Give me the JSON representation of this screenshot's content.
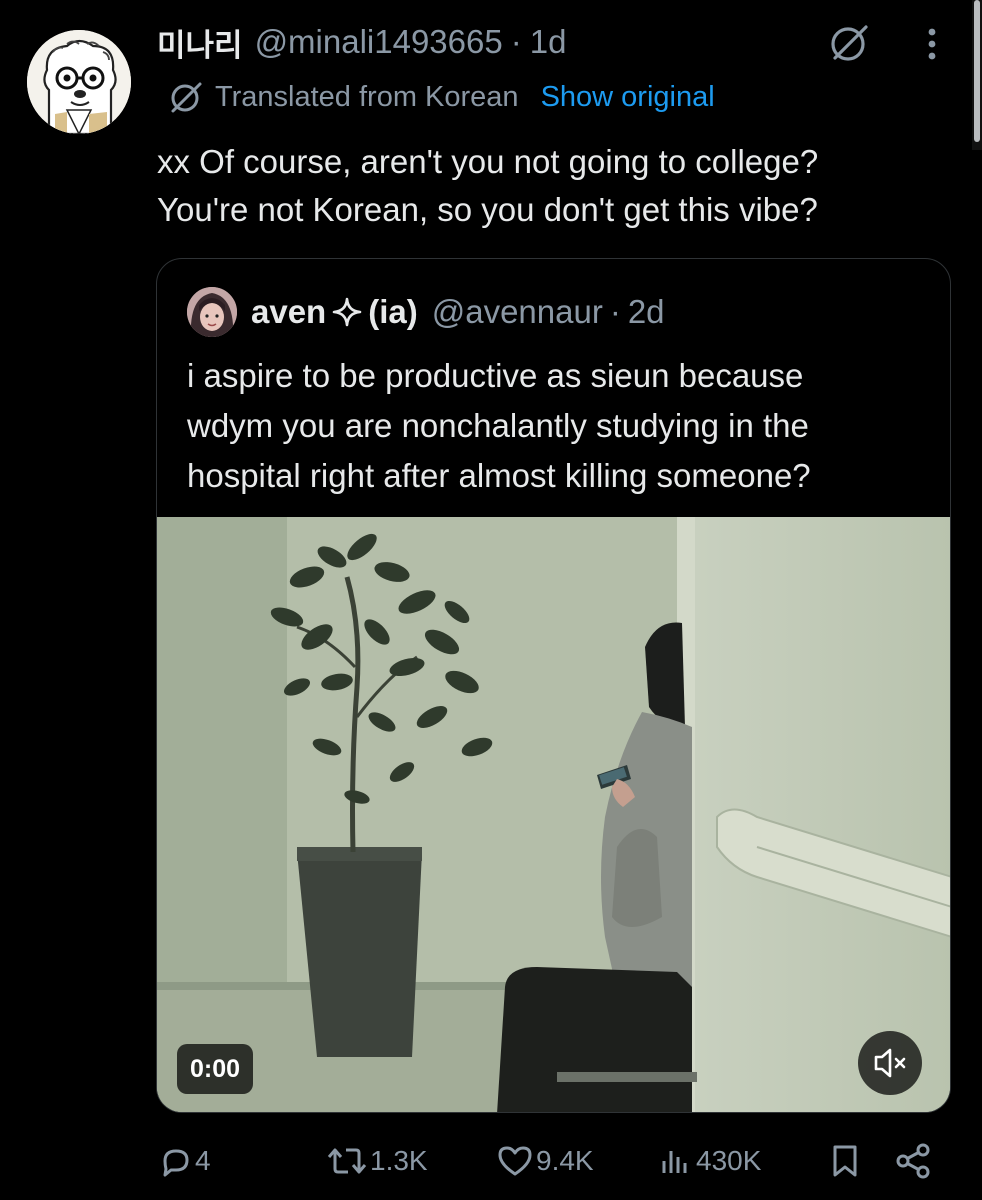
{
  "tweet": {
    "display_name": "미나리",
    "handle": "@minali1493665",
    "separator": "·",
    "time": "1d",
    "translated_label": "Translated from Korean",
    "show_original_label": "Show original",
    "text_line1": "xx Of course, aren't you not going to college?",
    "text_line2": "You're not Korean, so you don't get this vibe?"
  },
  "quote": {
    "name": "aven",
    "affiliation": "(ia)",
    "handle": "@avennaur",
    "separator": "·",
    "time": "2d",
    "text_line1": "i aspire to be productive as sieun because",
    "text_line2": "wdym you are nonchalantly studying in the",
    "text_line3": "hospital right after almost killing someone?",
    "video_time": "0:00"
  },
  "actions": {
    "replies": "4",
    "reposts": "1.3K",
    "likes": "9.4K",
    "views": "430K"
  },
  "colors": {
    "background": "#000000",
    "text": "#e7e9ea",
    "muted": "#8b98a5",
    "link": "#1d9bf0",
    "border": "#2f3336"
  },
  "icons": [
    "translate-icon",
    "grok-icon",
    "more-icon",
    "sparkle-icon",
    "mute-icon",
    "reply-icon",
    "repost-icon",
    "like-icon",
    "views-icon",
    "bookmark-icon",
    "share-icon"
  ]
}
